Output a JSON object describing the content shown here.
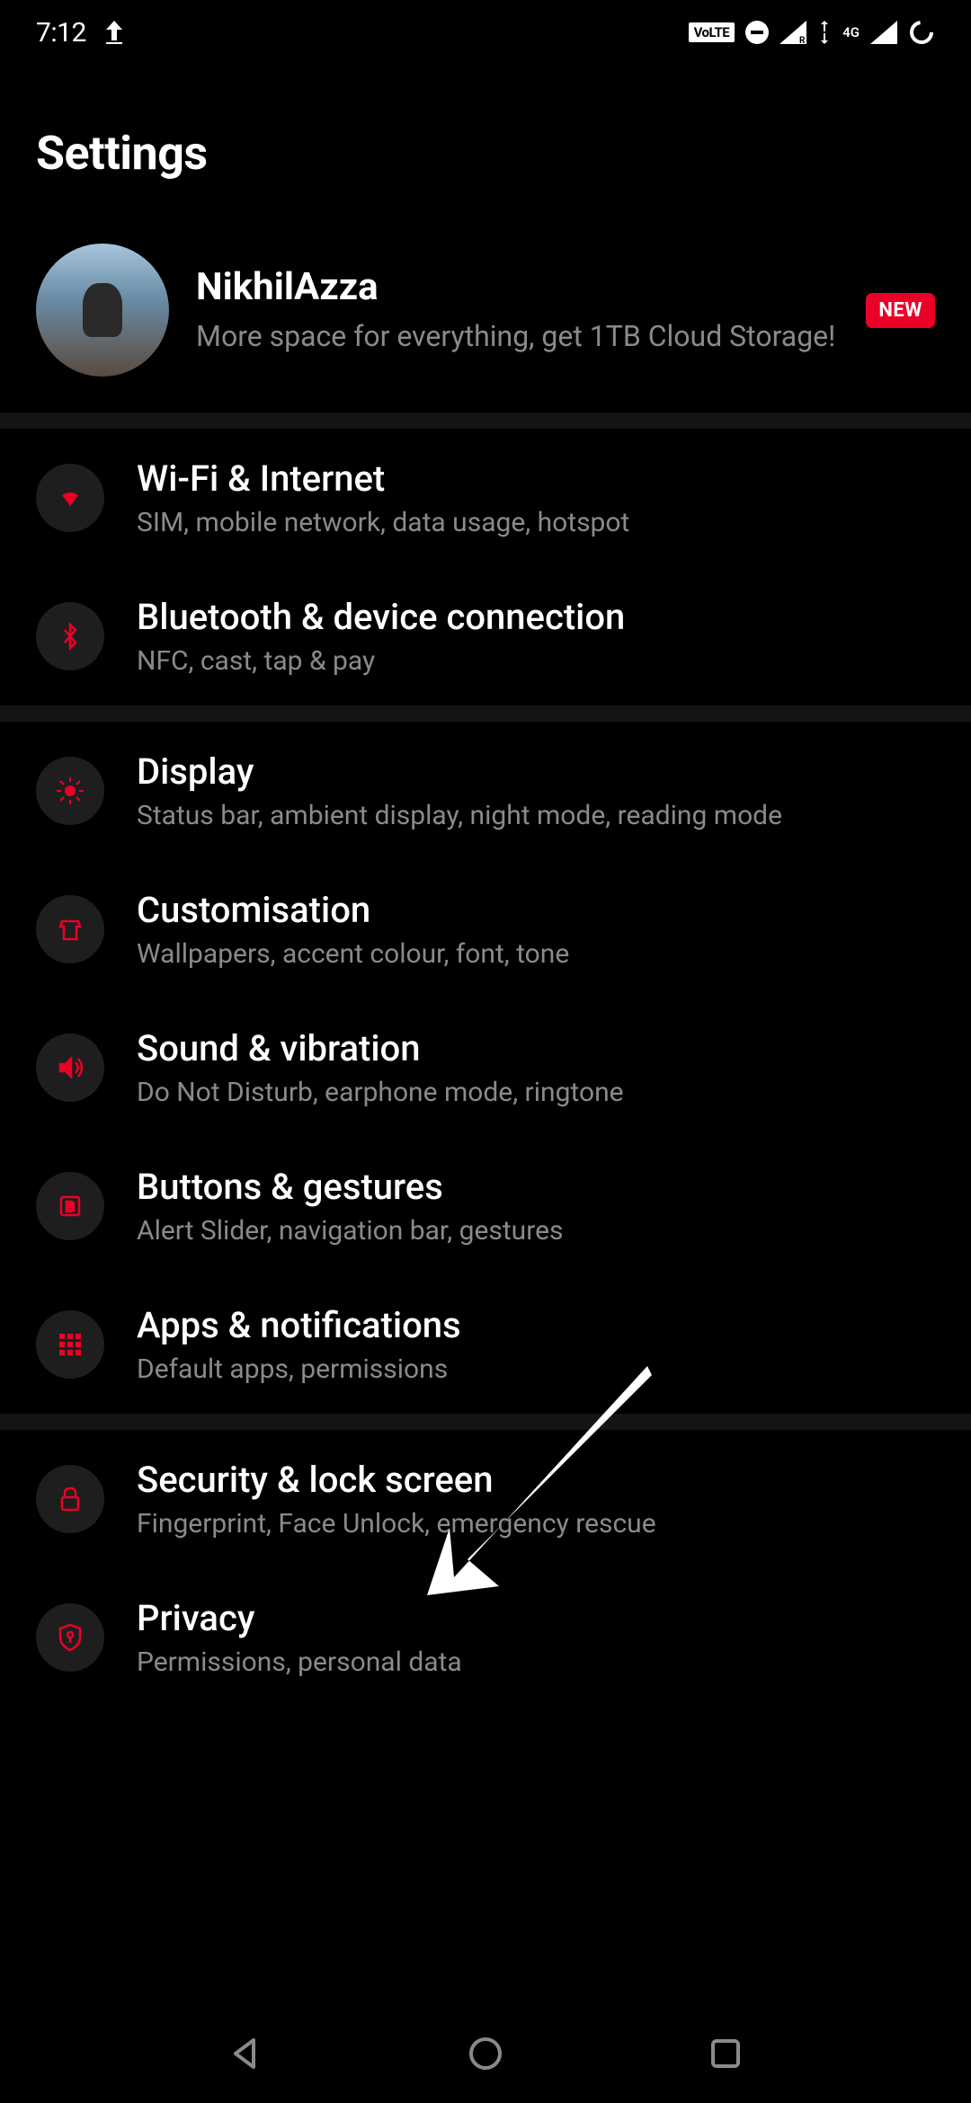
{
  "status": {
    "time": "7:12",
    "volte": "VoLTE",
    "network": "4G"
  },
  "page": {
    "title": "Settings"
  },
  "profile": {
    "name": "NikhilAzza",
    "promo": "More space for everything, get 1TB Cloud Storage!",
    "badge": "NEW"
  },
  "items": [
    {
      "title": "Wi-Fi & Internet",
      "sub": "SIM, mobile network, data usage, hotspot"
    },
    {
      "title": "Bluetooth & device connection",
      "sub": "NFC, cast, tap & pay"
    },
    {
      "title": "Display",
      "sub": "Status bar, ambient display, night mode, reading mode"
    },
    {
      "title": "Customisation",
      "sub": "Wallpapers, accent colour, font, tone"
    },
    {
      "title": "Sound & vibration",
      "sub": "Do Not Disturb, earphone mode, ringtone"
    },
    {
      "title": "Buttons & gestures",
      "sub": "Alert Slider, navigation bar, gestures"
    },
    {
      "title": "Apps & notifications",
      "sub": "Default apps, permissions"
    },
    {
      "title": "Security & lock screen",
      "sub": "Fingerprint, Face Unlock, emergency rescue"
    },
    {
      "title": "Privacy",
      "sub": "Permissions, personal data"
    }
  ]
}
